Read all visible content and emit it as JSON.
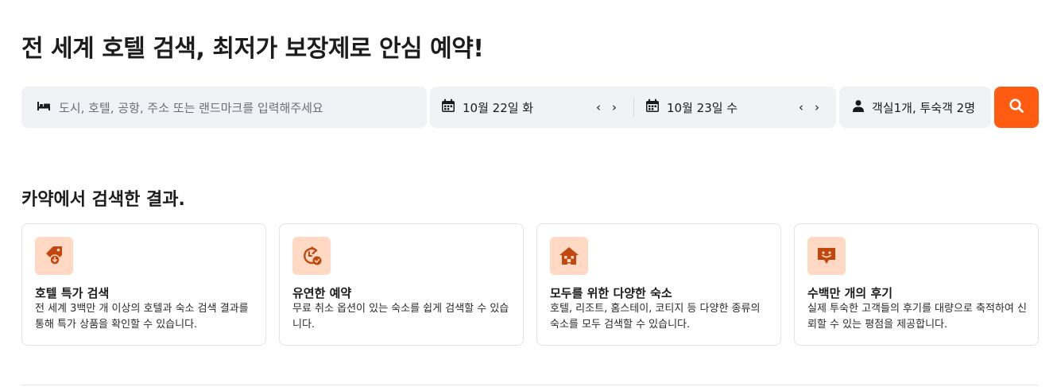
{
  "page": {
    "title": "전 세계 호텔 검색, 최저가 보장제로 안심 예약!"
  },
  "search": {
    "destination_placeholder": "도시, 호텔, 공항, 주소 또는 랜드마크를 입력해주세요",
    "checkin": "10월 22일 화",
    "checkout": "10월 23일 수",
    "prev_arrow": "‹",
    "next_arrow": "›",
    "guests": "객실1개, 투숙객 2명",
    "icons": {
      "destination": "bed-icon",
      "dates": "calendar-icon",
      "guests": "person-icon",
      "submit": "search-icon"
    },
    "button_color": "#ff5b11"
  },
  "results": {
    "heading": "카약에서 검색한 결과.",
    "cards": [
      {
        "icon": "price-tag-icon",
        "title": "호텔 특가 검색",
        "desc": "전 세계 3백만 개 이상의 호텔과 숙소 검색 결과를 통해 특가 상품을 확인할 수 있습니다."
      },
      {
        "icon": "flexible-booking-icon",
        "title": "유연한 예약",
        "desc": "무료 취소 옵션이 있는 숙소를 쉽게 검색할 수 있습니다."
      },
      {
        "icon": "house-icon",
        "title": "모두를 위한 다양한 숙소",
        "desc": "호텔, 리조트, 홈스테이, 코티지 등 다양한 종류의 숙소를 모두 검색할 수 있습니다."
      },
      {
        "icon": "review-chat-icon",
        "title": "수백만 개의 후기",
        "desc": "실제 투숙한 고객들의 후기를 대량으로 축적하여 신뢰할 수 있는 평점을 제공합니다."
      }
    ],
    "icon_bg": "#ffd9c4",
    "icon_color": "#c2470f"
  }
}
